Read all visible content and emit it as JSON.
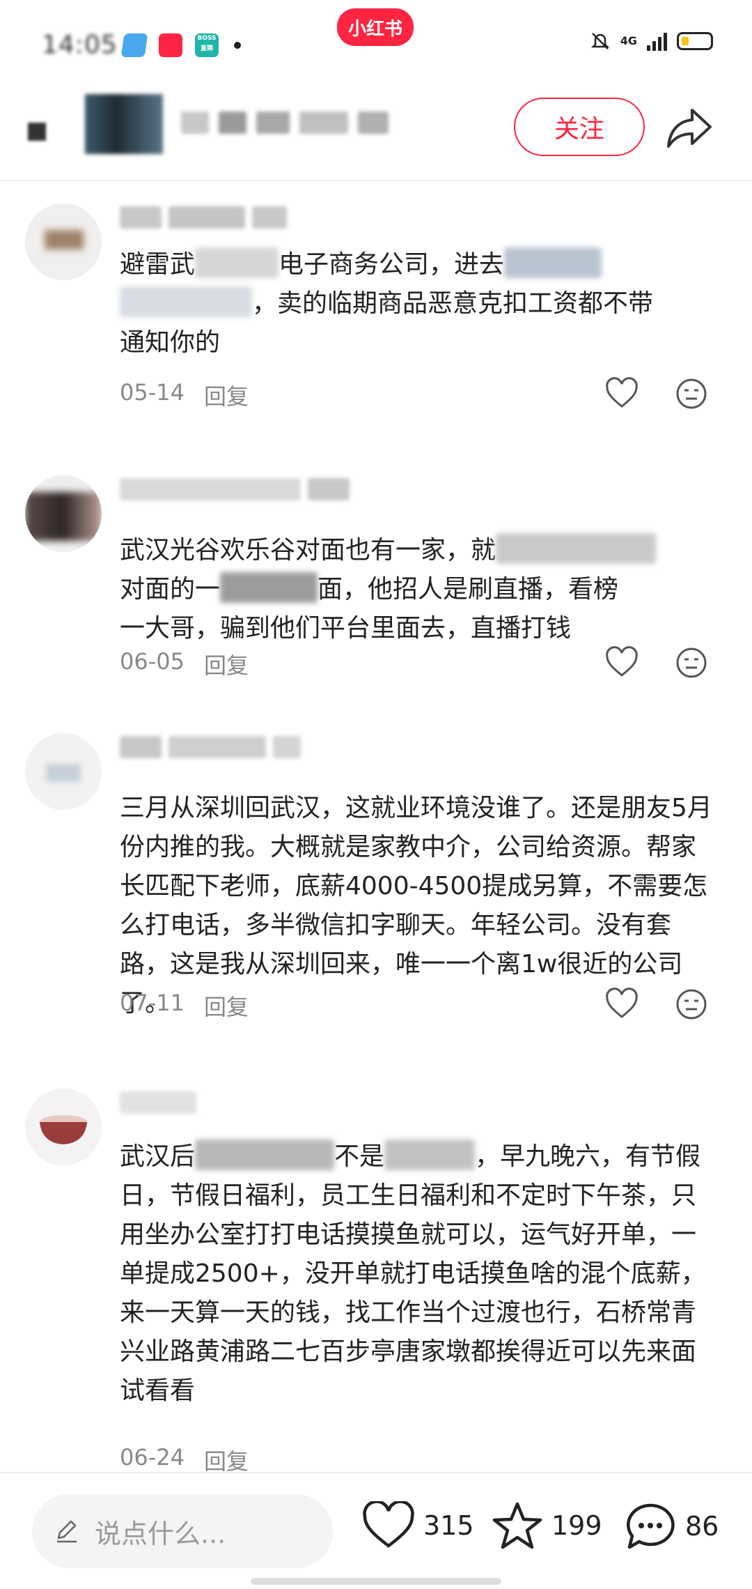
{
  "status_bar": {
    "time": "14:05",
    "network": "4G",
    "app_logo": "小红书",
    "boss_label_1": "BOSS",
    "boss_label_2": "直聘"
  },
  "header": {
    "follow_label": "关注"
  },
  "comments": [
    {
      "text_a": "避雷武",
      "text_b": "电子商务公司，进去",
      "text_c": "，卖的临期商品恶意克扣工资都不带",
      "text_d": "通知你的",
      "date": "05-14",
      "reply_label": "回复"
    },
    {
      "text_a": "武汉光谷欢乐谷对面也有一家，就",
      "text_b": "对面的一",
      "text_c": "面，他招人是刷直播，看榜",
      "text_d": "一大哥，骗到他们平台里面去，直播打钱",
      "date": "06-05",
      "reply_label": "回复"
    },
    {
      "text": "三月从深圳回武汉，这就业环境没谁了。还是朋友5月份内推的我。大概就是家教中介，公司给资源。帮家长匹配下老师，底薪4000-4500提成另算，不需要怎么打电话，多半微信扣字聊天。年轻公司。没有套路，这是我从深圳回来，唯一一个离1w很近的公司了。",
      "date": "07-11",
      "reply_label": "回复"
    },
    {
      "text_a": "武汉后",
      "text_b": "不是",
      "text_c": "，早九晚六，有节假日，节假日福利，员工生日福利和不定时下午茶，只用坐办公室打打电话摸摸鱼就可以，运气好开单，一单提成2500+，没开单就打电话摸鱼啥的混个底薪，来一天算一天的钱，找工作当个过渡也行，石桥常青兴业路黄浦路二七百步亭唐家墩都挨得近可以先来面试看看",
      "date": "06-24",
      "reply_label": "回复"
    }
  ],
  "bottom_bar": {
    "input_placeholder": "说点什么...",
    "likes": "315",
    "favorites": "199",
    "comments": "86"
  },
  "colors": {
    "accent": "#ff2442",
    "text": "#222222",
    "meta": "#888888"
  },
  "icons": [
    "back-icon",
    "share-icon",
    "heart-icon",
    "dislike-icon",
    "star-icon",
    "chat-icon",
    "pencil-icon",
    "bell-mute-icon",
    "battery-icon"
  ]
}
